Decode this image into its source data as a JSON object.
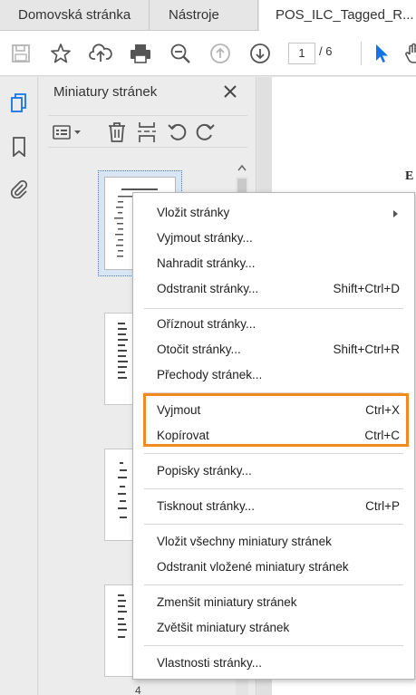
{
  "tabs": [
    {
      "label": "Domovská stránka"
    },
    {
      "label": "Nástroje"
    },
    {
      "label": "POS_ILC_Tagged_R..."
    }
  ],
  "toolbar": {
    "page_current": "1",
    "page_total": "/ 6",
    "icons": [
      "save-icon",
      "star-icon",
      "cloud-upload-icon",
      "print-icon",
      "zoom-out-icon",
      "page-up-icon",
      "page-down-icon",
      "select-cursor-icon",
      "hand-icon"
    ]
  },
  "rail": {
    "icons": [
      "pages-icon",
      "bookmark-icon",
      "attachment-icon"
    ]
  },
  "panel": {
    "title": "Miniatury stránek",
    "tools": [
      "options-icon",
      "delete-icon",
      "insert-page-icon",
      "rotate-left-icon",
      "rotate-right-icon"
    ],
    "thumbnail_number": "4"
  },
  "document": {
    "visible_text": "E"
  },
  "menu": {
    "items": [
      {
        "label": "Vložit stránky",
        "shortcut": "",
        "submenu": true
      },
      {
        "label": "Vyjmout stránky...",
        "shortcut": ""
      },
      {
        "label": "Nahradit stránky...",
        "shortcut": ""
      },
      {
        "label": "Odstranit stránky...",
        "shortcut": "Shift+Ctrl+D"
      },
      {
        "label": "Oříznout stránky...",
        "shortcut": ""
      },
      {
        "label": "Otočit stránky...",
        "shortcut": "Shift+Ctrl+R"
      },
      {
        "label": "Přechody stránek...",
        "shortcut": ""
      },
      {
        "label": "Vyjmout",
        "shortcut": "Ctrl+X"
      },
      {
        "label": "Kopírovat",
        "shortcut": "Ctrl+C"
      },
      {
        "label": "Popisky stránky...",
        "shortcut": ""
      },
      {
        "label": "Tisknout stránky...",
        "shortcut": "Ctrl+P"
      },
      {
        "label": "Vložit všechny miniatury stránek",
        "shortcut": ""
      },
      {
        "label": "Odstranit vložené miniatury stránek",
        "shortcut": ""
      },
      {
        "label": "Zmenšit miniatury stránek",
        "shortcut": ""
      },
      {
        "label": "Zvětšit miniatury stránek",
        "shortcut": ""
      },
      {
        "label": "Vlastnosti stránky...",
        "shortcut": ""
      }
    ]
  },
  "colors": {
    "highlight": "#f28a22",
    "accent": "#1473e6"
  }
}
